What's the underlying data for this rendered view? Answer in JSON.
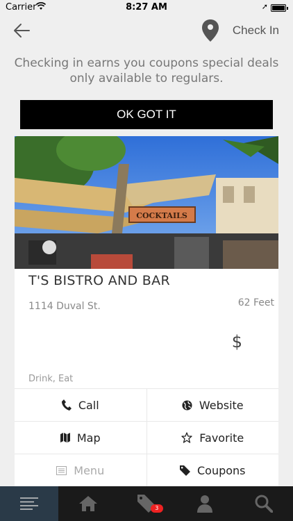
{
  "status_bar": {
    "carrier": "Carrier",
    "time": "8:27 AM"
  },
  "nav": {
    "checkin_label": "Check In"
  },
  "info_text": "Checking in earns you coupons special deals only available to regulars.",
  "ok_button_label": "OK GOT IT",
  "venue": {
    "sign_text": "COCKTAILS",
    "name": "T'S BISTRO AND BAR",
    "address": "1114 Duval St.",
    "distance": "62 Feet",
    "price": "$",
    "categories": "Drink, Eat"
  },
  "actions": {
    "call": "Call",
    "website": "Website",
    "map": "Map",
    "favorite": "Favorite",
    "menu": "Menu",
    "coupons": "Coupons"
  },
  "tabs": {
    "coupons_badge": "3"
  },
  "icons": [
    "back-arrow-icon",
    "map-pin-icon",
    "phone-icon",
    "globe-icon",
    "map-icon",
    "star-icon",
    "menu-list-icon",
    "tag-icon",
    "home-icon",
    "user-icon",
    "search-icon"
  ],
  "colors": {
    "badge": "#e22",
    "active_tab": "#2a3a48",
    "button": "#000000"
  }
}
